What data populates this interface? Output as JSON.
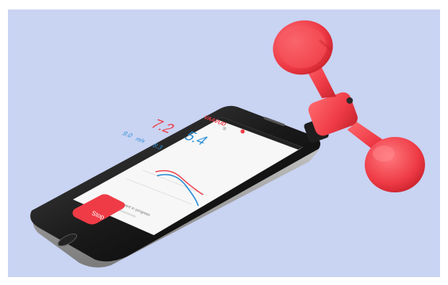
{
  "colors": {
    "background": "#c9d3f2",
    "device_accent": "#ef3b46",
    "data_blue": "#2b8fd6"
  },
  "app": {
    "brand": "VAAVUD",
    "readings": {
      "primary_red": "7.2",
      "primary_blue": "5.4",
      "secondary": [
        "9.0",
        "m/s",
        "8.3"
      ]
    },
    "status_text": "Measurement in progress",
    "stop_label": "Stop",
    "progress": 0.45
  },
  "anemometer": {
    "logo_text": "vaavud"
  }
}
